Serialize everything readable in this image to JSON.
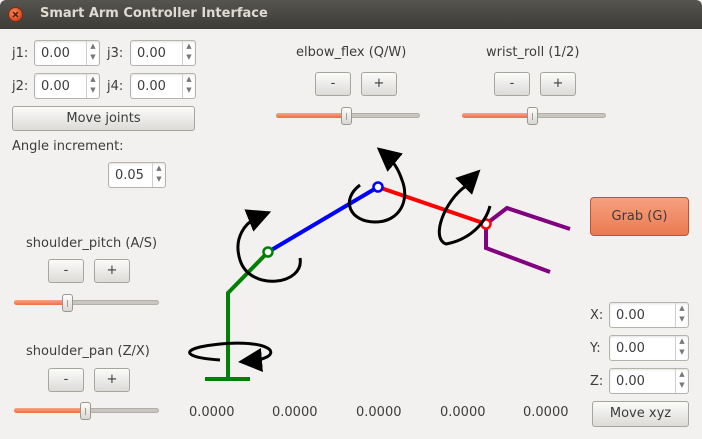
{
  "window": {
    "title": "Smart Arm Controller Interface"
  },
  "joints": {
    "j1": {
      "label": "j1:",
      "value": "0.00"
    },
    "j2": {
      "label": "j2:",
      "value": "0.00"
    },
    "j3": {
      "label": "j3:",
      "value": "0.00"
    },
    "j4": {
      "label": "j4:",
      "value": "0.00"
    },
    "move_label": "Move joints"
  },
  "increment": {
    "label": "Angle increment:",
    "value": "0.05"
  },
  "controls": {
    "elbow_flex": {
      "label": "elbow_flex (Q/W)",
      "minus": "-",
      "plus": "+",
      "level": 0.49
    },
    "wrist_roll": {
      "label": "wrist_roll (1/2)",
      "minus": "-",
      "plus": "+",
      "level": 0.49
    },
    "shoulder_pitch": {
      "label": "shoulder_pitch (A/S)",
      "minus": "-",
      "plus": "+",
      "level": 0.36
    },
    "shoulder_pan": {
      "label": "shoulder_pan (Z/X)",
      "minus": "-",
      "plus": "+",
      "level": 0.49
    }
  },
  "grab": {
    "label": "Grab (G)"
  },
  "xyz": {
    "x": {
      "label": "X:",
      "value": "0.00"
    },
    "y": {
      "label": "Y:",
      "value": "0.00"
    },
    "z": {
      "label": "Z:",
      "value": "0.00"
    },
    "move_label": "Move xyz"
  },
  "readouts": [
    "0.0000",
    "0.0000",
    "0.0000",
    "0.0000",
    "0.0000"
  ],
  "colors": {
    "accent": "#ec6f46",
    "base_link": "#008000",
    "upper_arm": "#0000ff",
    "forearm": "#ff0000",
    "gripper": "#800080"
  }
}
